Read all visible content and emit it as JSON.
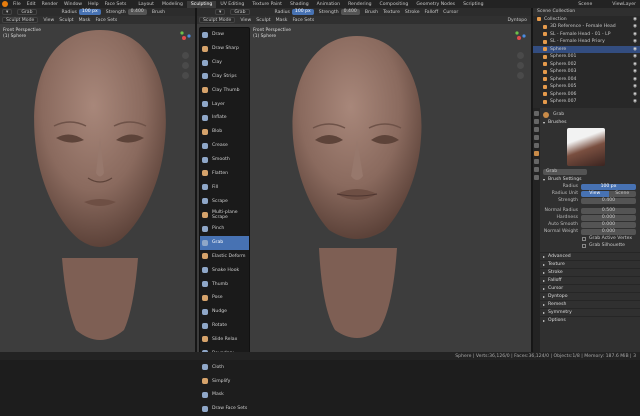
{
  "topbar": {
    "menus": [
      "File",
      "Edit",
      "Render",
      "Window",
      "Help"
    ],
    "face_sets": "Face Sets",
    "workspaces": [
      "Layout",
      "Modeling",
      "Sculpting",
      "UV Editing",
      "Texture Paint",
      "Shading",
      "Animation",
      "Rendering",
      "Compositing",
      "Geometry Nodes",
      "Scripting"
    ],
    "active_workspace": "Sculpting",
    "scene": "Scene",
    "view_layer": "ViewLayer"
  },
  "viewport_left": {
    "mode": "Sculpt Mode",
    "menus": [
      "View",
      "Sculpt",
      "Mask",
      "Face Sets"
    ],
    "title": "Front Perspective",
    "subtitle": "(1) Sphere",
    "brush": "Grab",
    "radius_label": "Radius",
    "radius_value": "100 px",
    "strength_label": "Strength",
    "strength_value": "0.400",
    "brush_label": "Brush"
  },
  "viewport_right": {
    "mode": "Sculpt Mode",
    "menus": [
      "View",
      "Sculpt",
      "Mask",
      "Face Sets"
    ],
    "title": "Front Perspective",
    "subtitle": "(1) Sphere",
    "brush": "Grab",
    "radius_label": "Radius",
    "radius_value": "100 px",
    "strength_label": "Strength",
    "strength_value": "0.400",
    "extra": [
      "Brush",
      "Texture",
      "Stroke",
      "Falloff",
      "Cursor"
    ],
    "dyntopo": "Dyntopo"
  },
  "brush_menu": [
    "Draw",
    "Draw Sharp",
    "Clay",
    "Clay Strips",
    "Clay Thumb",
    "Layer",
    "Inflate",
    "Blob",
    "Crease",
    "Smooth",
    "Flatten",
    "Fill",
    "Scrape",
    "Multi-plane Scrape",
    "Pinch",
    "Grab",
    "Elastic Deform",
    "Snake Hook",
    "Thumb",
    "Pose",
    "Nudge",
    "Rotate",
    "Slide Relax",
    "Boundary",
    "Cloth",
    "Simplify",
    "Mask",
    "Draw Face Sets"
  ],
  "selected_brush": "Grab",
  "outliner": {
    "title": "Scene Collection",
    "rows": [
      {
        "label": "Collection",
        "sel": false
      },
      {
        "label": "3D Reference - Female Head",
        "sel": false
      },
      {
        "label": "SL - Female Head - 01 - LP",
        "sel": false
      },
      {
        "label": "SL - Female Head Priory",
        "sel": false
      },
      {
        "label": "Sphere",
        "sel": true
      },
      {
        "label": "Sphere.001",
        "sel": false
      },
      {
        "label": "Sphere.002",
        "sel": false
      },
      {
        "label": "Sphere.003",
        "sel": false
      },
      {
        "label": "Sphere.004",
        "sel": false
      },
      {
        "label": "Sphere.005",
        "sel": false
      },
      {
        "label": "Sphere.006",
        "sel": false
      },
      {
        "label": "Sphere.007",
        "sel": false
      }
    ]
  },
  "properties": {
    "brush_name": "Grab",
    "brushes_label": "Brushes",
    "preview_name": "Grab",
    "brush_settings_label": "Brush Settings",
    "radius_label": "Radius",
    "radius_value": "100 px",
    "radius_unit_label": "Radius Unit",
    "radius_unit_view": "View",
    "radius_unit_scene": "Scene",
    "strength_label": "Strength",
    "strength_value": "0.400",
    "normal_radius_label": "Normal Radius",
    "normal_radius_value": "0.500",
    "hardness_label": "Hardness",
    "hardness_value": "0.000",
    "auto_smooth_label": "Auto Smooth",
    "auto_smooth_value": "0.000",
    "normal_weight_label": "Normal Weight",
    "normal_weight_value": "0.000",
    "grab_active_vertex": "Grab Active Vertex",
    "grab_silhouette": "Grab Silhouette",
    "sections": [
      "Advanced",
      "Texture",
      "Stroke",
      "Falloff",
      "Cursor",
      "Dyntopo",
      "Remesh",
      "Symmetry",
      "Options"
    ]
  },
  "statusbar": "Sphere | Verts:36,126/0 | Faces:36,124/0 | Objects:1/8 | Memory: 187.6 MiB | 3"
}
